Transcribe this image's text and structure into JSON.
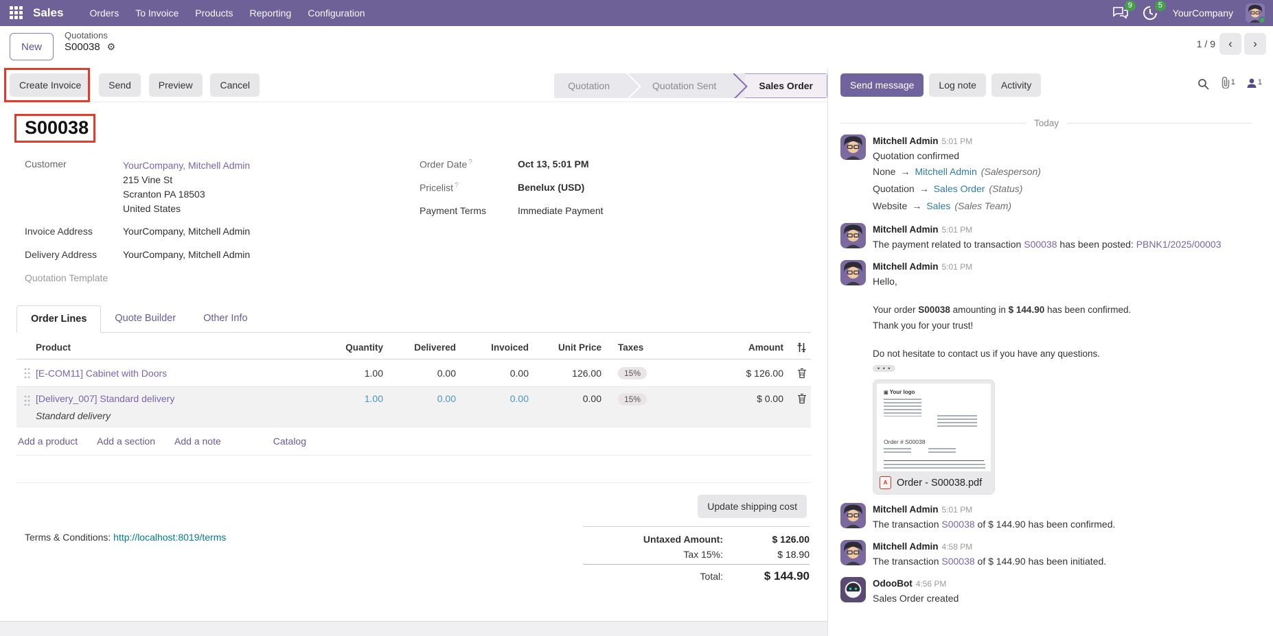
{
  "icons": {
    "gear": "⚙",
    "prev": "‹",
    "next": "›",
    "arrow": "→",
    "expander": "• • •"
  },
  "navbar": {
    "app": "Sales",
    "menus": [
      "Orders",
      "To Invoice",
      "Products",
      "Reporting",
      "Configuration"
    ],
    "message_badge": "9",
    "activity_badge": "5",
    "company": "YourCompany"
  },
  "control": {
    "new_label": "New",
    "breadcrumb_parent": "Quotations",
    "breadcrumb_current": "S00038",
    "pager": "1 / 9"
  },
  "actions": {
    "create_invoice": "Create Invoice",
    "send": "Send",
    "preview": "Preview",
    "cancel": "Cancel"
  },
  "statusbar": {
    "steps": [
      "Quotation",
      "Quotation Sent",
      "Sales Order"
    ]
  },
  "form": {
    "title": "S00038",
    "customer_label": "Customer",
    "customer": "YourCompany, Mitchell Admin",
    "address_line1": "215 Vine St",
    "address_line2": "Scranton PA 18503",
    "address_line3": "United States",
    "invoice_address_label": "Invoice Address",
    "invoice_address": "YourCompany, Mitchell Admin",
    "delivery_address_label": "Delivery Address",
    "delivery_address": "YourCompany, Mitchell Admin",
    "quotation_template_label": "Quotation Template",
    "order_date_label": "Order Date",
    "order_date": "Oct 13, 5:01 PM",
    "pricelist_label": "Pricelist",
    "pricelist": "Benelux (USD)",
    "payment_terms_label": "Payment Terms",
    "payment_terms": "Immediate Payment",
    "help_mark": "?"
  },
  "tabs": {
    "order_lines": "Order Lines",
    "quote_builder": "Quote Builder",
    "other_info": "Other Info"
  },
  "table": {
    "headers": {
      "product": "Product",
      "quantity": "Quantity",
      "delivered": "Delivered",
      "invoiced": "Invoiced",
      "unit_price": "Unit Price",
      "taxes": "Taxes",
      "amount": "Amount"
    },
    "rows": [
      {
        "product": "[E-COM11] Cabinet with Doors",
        "quantity": "1.00",
        "delivered": "0.00",
        "invoiced": "0.00",
        "unit_price": "126.00",
        "tax": "15%",
        "amount": "$ 126.00"
      },
      {
        "product": "[Delivery_007] Standard delivery",
        "note": "Standard delivery",
        "quantity": "1.00",
        "delivered": "0.00",
        "invoiced": "0.00",
        "unit_price": "0.00",
        "tax": "15%",
        "amount": "$ 0.00"
      }
    ],
    "add_product": "Add a product",
    "add_section": "Add a section",
    "add_note": "Add a note",
    "catalog": "Catalog"
  },
  "totals": {
    "ship_button": "Update shipping cost",
    "untaxed_label": "Untaxed Amount:",
    "untaxed": "$ 126.00",
    "tax_label": "Tax 15%:",
    "tax": "$ 18.90",
    "total_label": "Total:",
    "total": "$ 144.90",
    "terms_label": "Terms & Conditions:",
    "terms_link": "http://localhost:8019/terms"
  },
  "chatter": {
    "send_message": "Send message",
    "log_note": "Log note",
    "activity": "Activity",
    "attachment_count": "1",
    "follower_count": "1",
    "today": "Today",
    "messages": [
      {
        "author": "Mitchell Admin",
        "time": "5:01 PM",
        "title": "Quotation confirmed",
        "tracks": [
          {
            "old": "None",
            "new": "Mitchell Admin",
            "field": "(Salesperson)"
          },
          {
            "old": "Quotation",
            "new": "Sales Order",
            "field": "(Status)"
          },
          {
            "old": "Website",
            "new": "Sales",
            "field": "(Sales Team)"
          }
        ]
      },
      {
        "author": "Mitchell Admin",
        "time": "5:01 PM",
        "seg1": "The payment related to transaction ",
        "link1": "S00038",
        "seg2": " has been posted: ",
        "link2": "PBNK1/2025/00003"
      },
      {
        "author": "Mitchell Admin",
        "time": "5:01 PM",
        "hello": "Hello,",
        "l1a": "Your order ",
        "l1b": "S00038",
        "l1c": " amounting in ",
        "l1d": "$ 144.90",
        "l1e": " has been confirmed.",
        "l2": "Thank you for your trust!",
        "l3": "Do not hesitate to contact us if you have any questions.",
        "attachment": {
          "filename": "Order - S00038.pdf",
          "logo": "Your logo",
          "order_no": "Order # S00038"
        }
      },
      {
        "author": "Mitchell Admin",
        "time": "5:01 PM",
        "seg1": "The transaction ",
        "link1": "S00038",
        "seg2": " of $ 144.90 has been confirmed."
      },
      {
        "author": "Mitchell Admin",
        "time": "4:58 PM",
        "seg1": "The transaction ",
        "link1": "S00038",
        "seg2": " of $ 144.90 has been initiated."
      },
      {
        "author": "OdooBot",
        "time": "4:56 PM",
        "body": "Sales Order created"
      }
    ]
  }
}
